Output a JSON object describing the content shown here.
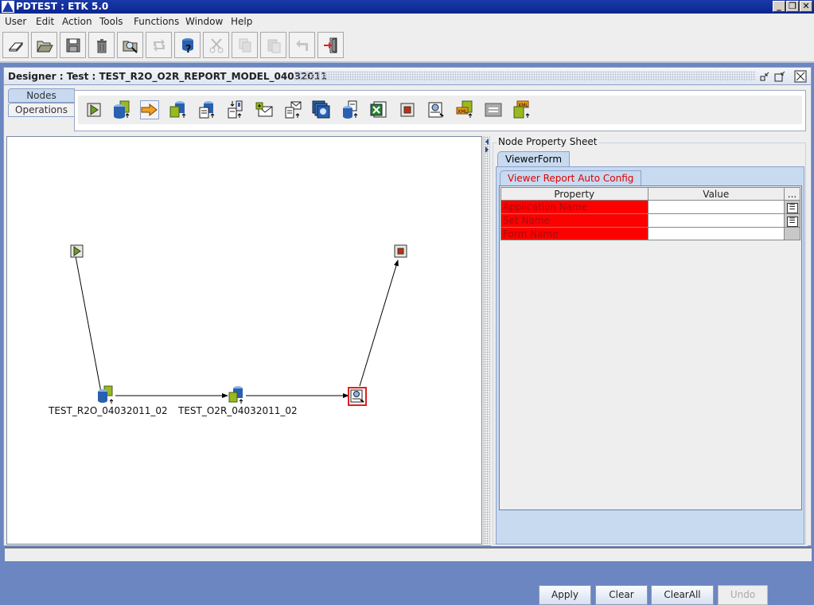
{
  "window": {
    "title": "PDTEST : ETK 5.0",
    "controls": [
      "minimize",
      "restore",
      "close"
    ]
  },
  "menu": [
    "User",
    "Edit",
    "Action",
    "Tools",
    "Functions",
    "Window",
    "Help"
  ],
  "toolbar": [
    {
      "name": "eraser-icon",
      "enabled": true
    },
    {
      "name": "open-folder-icon",
      "enabled": true
    },
    {
      "name": "save-icon",
      "enabled": true
    },
    {
      "name": "trash-icon",
      "enabled": true
    },
    {
      "name": "search-folder-icon",
      "enabled": true
    },
    {
      "name": "refresh-icon",
      "enabled": false
    },
    {
      "name": "database-help-icon",
      "enabled": true
    },
    {
      "name": "cut-icon",
      "enabled": false
    },
    {
      "name": "copy-icon",
      "enabled": false
    },
    {
      "name": "paste-icon",
      "enabled": false
    },
    {
      "name": "undo-icon",
      "enabled": false
    },
    {
      "name": "exit-icon",
      "enabled": true
    }
  ],
  "designer": {
    "title": "Designer : Test : TEST_R2O_O2R_REPORT_MODEL_04032011",
    "side_tabs": [
      "Nodes",
      "Operations"
    ],
    "active_side_tab": "Nodes",
    "node_palette": [
      "start-node-icon",
      "r2o-node-icon",
      "arrow-node-icon",
      "o2r-node-icon",
      "db-document-node-icon",
      "import-node-icon",
      "mail-add-node-icon",
      "mail-document-node-icon",
      "copy-db-node-icon",
      "db-report-node-icon",
      "excel-node-icon",
      "stop-node-icon",
      "viewer-node-icon",
      "xml-export-node-icon",
      "transform-node-icon",
      "xml-import-node-icon"
    ],
    "selected_palette_index": 2,
    "nodes": [
      {
        "id": "start",
        "type": "start",
        "label": ""
      },
      {
        "id": "r2o",
        "type": "r2o",
        "label": "TEST_R2O_04032011_02"
      },
      {
        "id": "o2r",
        "type": "o2r",
        "label": "TEST_O2R_04032011_02"
      },
      {
        "id": "viewer",
        "type": "viewer",
        "label": "",
        "selected": true
      },
      {
        "id": "stop",
        "type": "stop",
        "label": ""
      }
    ],
    "edges": [
      [
        "start",
        "r2o"
      ],
      [
        "r2o",
        "o2r"
      ],
      [
        "o2r",
        "viewer"
      ],
      [
        "viewer",
        "stop"
      ]
    ]
  },
  "property_sheet": {
    "title": "Node Property Sheet",
    "outer_tab": "ViewerForm",
    "inner_tab": "Viewer Report Auto Config",
    "columns": [
      "Property",
      "Value",
      "..."
    ],
    "rows": [
      {
        "property": "Application Name",
        "value": "",
        "has_button": true
      },
      {
        "property": "Set Name",
        "value": "",
        "has_button": true
      },
      {
        "property": "Form Name",
        "value": "",
        "has_button": false
      }
    ],
    "buttons": [
      {
        "label": "Apply",
        "enabled": true
      },
      {
        "label": "Clear",
        "enabled": true
      },
      {
        "label": "ClearAll",
        "enabled": true
      },
      {
        "label": "Undo",
        "enabled": false
      }
    ]
  },
  "status": ""
}
